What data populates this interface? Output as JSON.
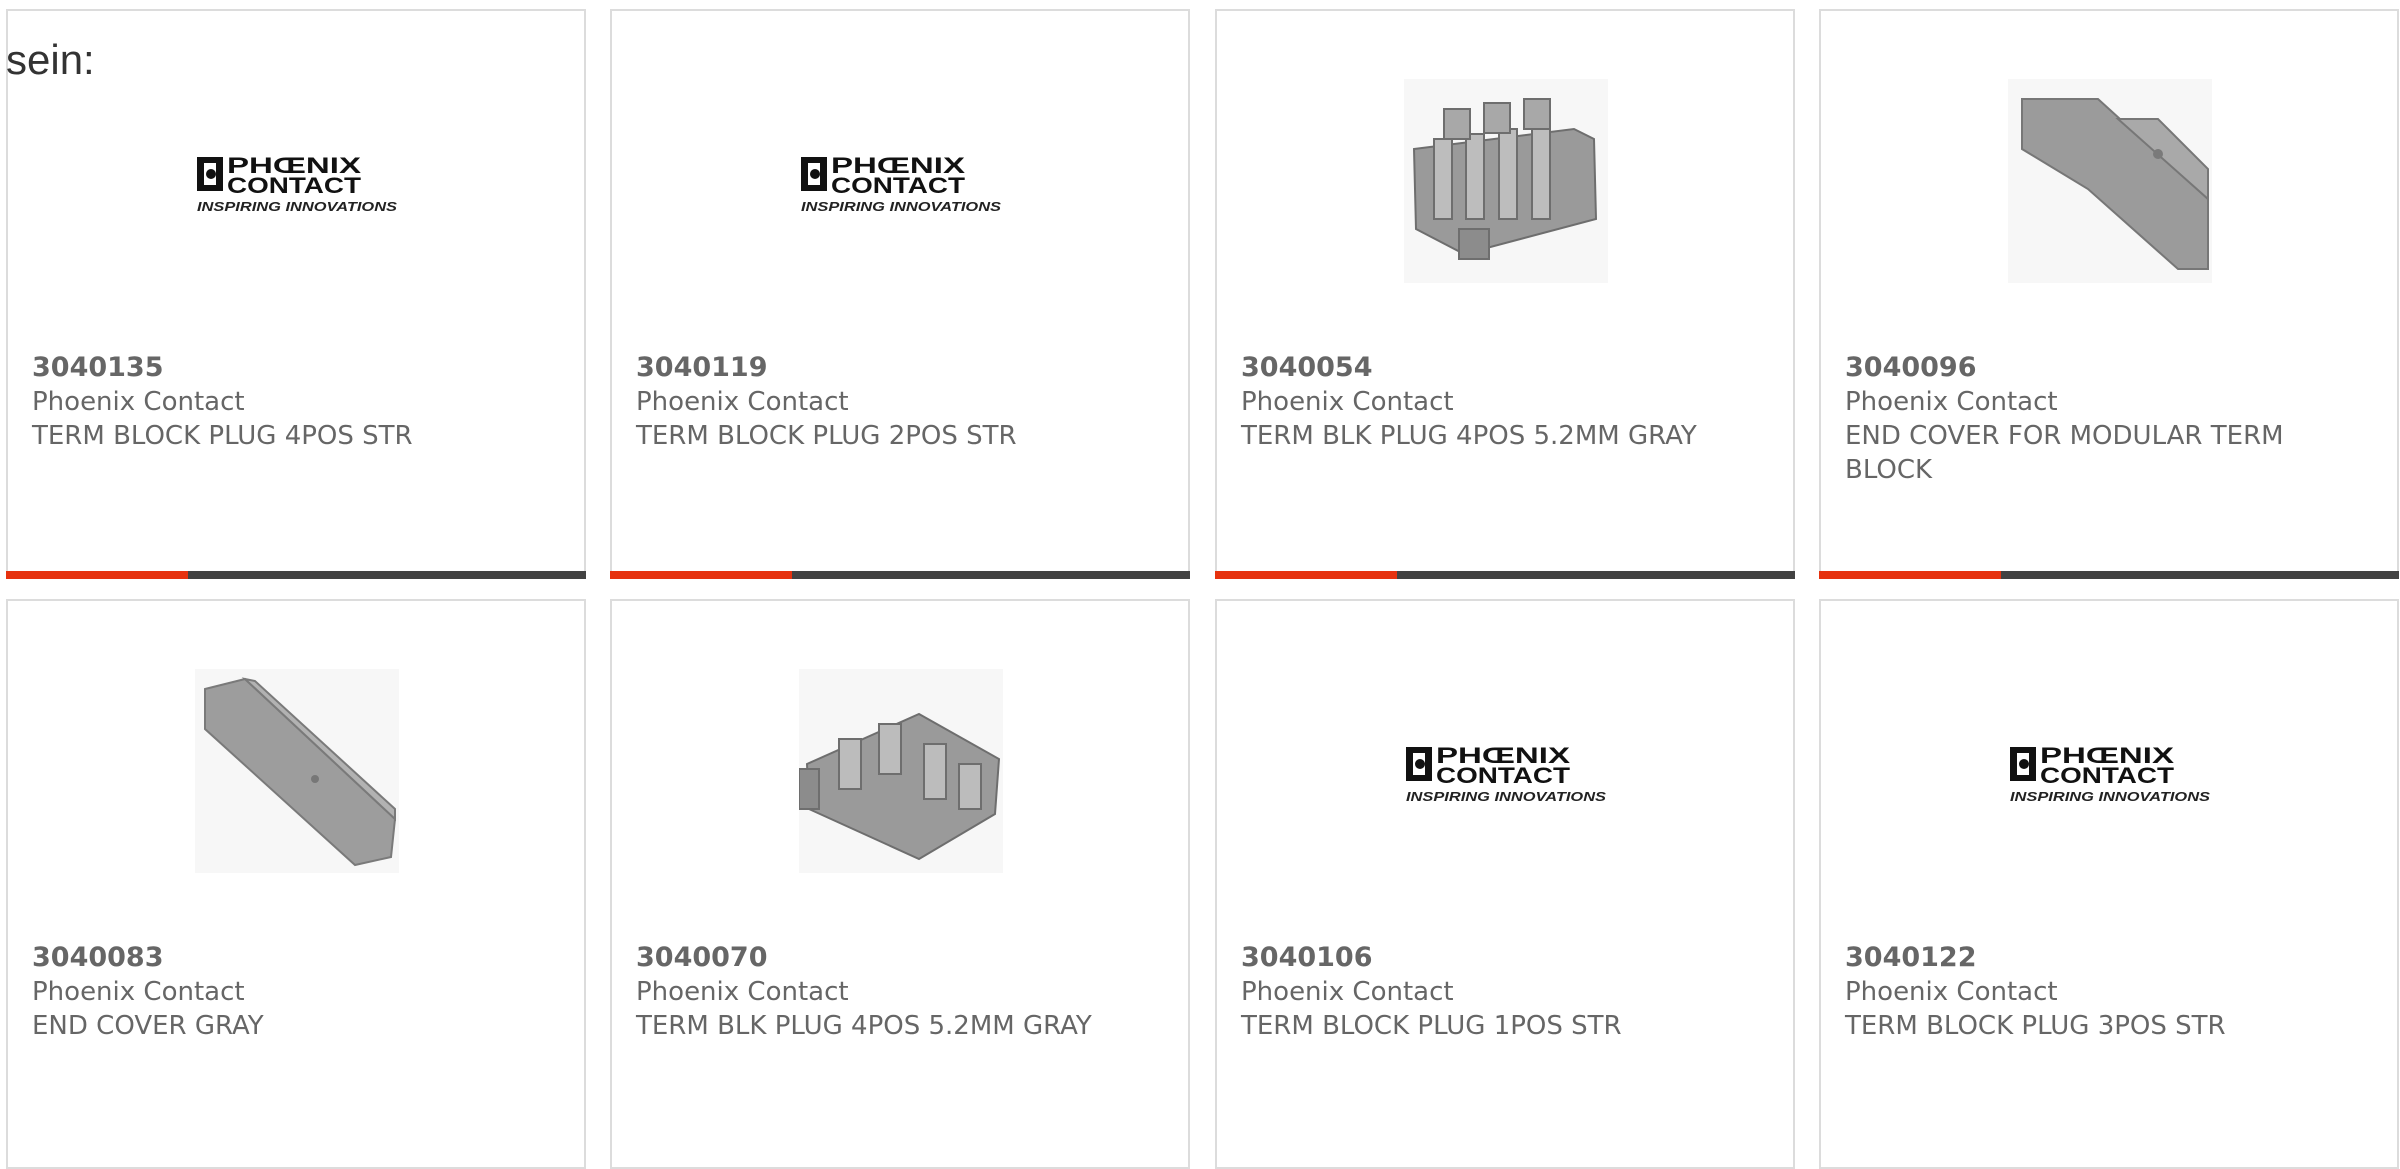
{
  "lead_text": "sein:",
  "accent_color": "#e6320f",
  "bar_color": "#424242",
  "products": [
    {
      "part_number": "3040135",
      "manufacturer": "Phoenix Contact",
      "description": "TERM BLOCK PLUG 4POS STR",
      "image": "phoenix-contact-logo",
      "logo_name": "PHŒNIX CONTACT",
      "logo_tagline": "INSPIRING INNOVATIONS"
    },
    {
      "part_number": "3040119",
      "manufacturer": "Phoenix Contact",
      "description": "TERM BLOCK PLUG 2POS STR",
      "image": "phoenix-contact-logo",
      "logo_name": "PHŒNIX CONTACT",
      "logo_tagline": "INSPIRING INNOVATIONS"
    },
    {
      "part_number": "3040054",
      "manufacturer": "Phoenix Contact",
      "description": "TERM BLK PLUG 4POS 5.2MM GRAY",
      "image": "terminal-block-photo"
    },
    {
      "part_number": "3040096",
      "manufacturer": "Phoenix Contact",
      "description": "END COVER FOR MODULAR TERM BLOCK",
      "image": "end-cover-photo"
    },
    {
      "part_number": "3040083",
      "manufacturer": "Phoenix Contact",
      "description": "END COVER GRAY",
      "image": "end-cover-gray-photo"
    },
    {
      "part_number": "3040070",
      "manufacturer": "Phoenix Contact",
      "description": "TERM BLK PLUG 4POS 5.2MM GRAY",
      "image": "terminal-block-angled-photo"
    },
    {
      "part_number": "3040106",
      "manufacturer": "Phoenix Contact",
      "description": "TERM BLOCK PLUG 1POS STR",
      "image": "phoenix-contact-logo",
      "logo_name": "PHŒNIX CONTACT",
      "logo_tagline": "INSPIRING INNOVATIONS"
    },
    {
      "part_number": "3040122",
      "manufacturer": "Phoenix Contact",
      "description": "TERM BLOCK PLUG 3POS STR",
      "image": "phoenix-contact-logo",
      "logo_name": "PHŒNIX CONTACT",
      "logo_tagline": "INSPIRING INNOVATIONS"
    }
  ]
}
